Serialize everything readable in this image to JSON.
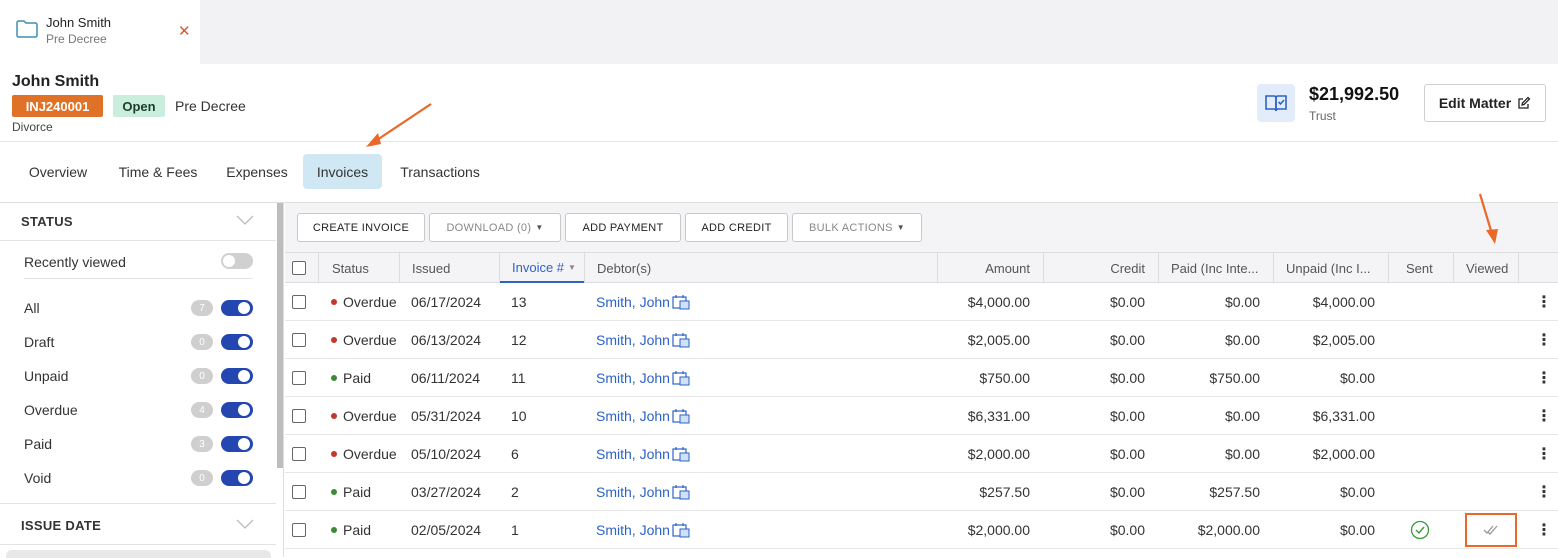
{
  "doc_tab": {
    "title": "John Smith",
    "subtitle": "Pre Decree",
    "close_glyph": "✕"
  },
  "matter": {
    "name": "John Smith",
    "code": "INJ240001",
    "status": "Open",
    "stage": "Pre Decree",
    "type": "Divorce",
    "trust_amount": "$21,992.50",
    "trust_label": "Trust",
    "edit_label": "Edit Matter"
  },
  "tabs": [
    {
      "label": "Overview"
    },
    {
      "label": "Time & Fees"
    },
    {
      "label": "Expenses"
    },
    {
      "label": "Invoices",
      "active": true
    },
    {
      "label": "Transactions"
    }
  ],
  "sidebar": {
    "status_title": "STATUS",
    "recently_viewed": "Recently viewed",
    "filters": [
      {
        "label": "All",
        "count": "7"
      },
      {
        "label": "Draft",
        "count": "0"
      },
      {
        "label": "Unpaid",
        "count": "0"
      },
      {
        "label": "Overdue",
        "count": "4"
      },
      {
        "label": "Paid",
        "count": "3"
      },
      {
        "label": "Void",
        "count": "0"
      }
    ],
    "issue_date_title": "ISSUE DATE"
  },
  "toolbar": {
    "create": "CREATE INVOICE",
    "download": "DOWNLOAD (0)",
    "add_payment": "ADD PAYMENT",
    "add_credit": "ADD CREDIT",
    "bulk": "BULK ACTIONS"
  },
  "columns": {
    "status": "Status",
    "issued": "Issued",
    "invoice": "Invoice #",
    "debtor": "Debtor(s)",
    "amount": "Amount",
    "credit": "Credit",
    "paid": "Paid (Inc Inte...",
    "unpaid": "Unpaid (Inc I...",
    "sent": "Sent",
    "viewed": "Viewed"
  },
  "invoices": [
    {
      "status": "Overdue",
      "status_color": "#c0392b",
      "issued": "06/17/2024",
      "number": "13",
      "debtor": "Smith, John",
      "amount": "$4,000.00",
      "credit": "$0.00",
      "paid": "$0.00",
      "unpaid": "$4,000.00"
    },
    {
      "status": "Overdue",
      "status_color": "#c0392b",
      "issued": "06/13/2024",
      "number": "12",
      "debtor": "Smith, John",
      "amount": "$2,005.00",
      "credit": "$0.00",
      "paid": "$0.00",
      "unpaid": "$2,005.00"
    },
    {
      "status": "Paid",
      "status_color": "#3a8a3a",
      "issued": "06/11/2024",
      "number": "11",
      "debtor": "Smith, John",
      "amount": "$750.00",
      "credit": "$0.00",
      "paid": "$750.00",
      "unpaid": "$0.00"
    },
    {
      "status": "Overdue",
      "status_color": "#c0392b",
      "issued": "05/31/2024",
      "number": "10",
      "debtor": "Smith, John",
      "amount": "$6,331.00",
      "credit": "$0.00",
      "paid": "$0.00",
      "unpaid": "$6,331.00"
    },
    {
      "status": "Overdue",
      "status_color": "#c0392b",
      "issued": "05/10/2024",
      "number": "6",
      "debtor": "Smith, John",
      "amount": "$2,000.00",
      "credit": "$0.00",
      "paid": "$0.00",
      "unpaid": "$2,000.00"
    },
    {
      "status": "Paid",
      "status_color": "#3a8a3a",
      "issued": "03/27/2024",
      "number": "2",
      "debtor": "Smith, John",
      "amount": "$257.50",
      "credit": "$0.00",
      "paid": "$257.50",
      "unpaid": "$0.00"
    },
    {
      "status": "Paid",
      "status_color": "#3a8a3a",
      "issued": "02/05/2024",
      "number": "1",
      "debtor": "Smith, John",
      "amount": "$2,000.00",
      "credit": "$0.00",
      "paid": "$2,000.00",
      "unpaid": "$0.00",
      "sent": true,
      "viewed": true
    }
  ],
  "colors": {
    "accent": "#2346b0",
    "link": "#2d62c9",
    "code_badge": "#df7226",
    "open_badge": "#c9eedb",
    "active_tab": "#cfe8f3",
    "annotation": "#e8692a"
  }
}
